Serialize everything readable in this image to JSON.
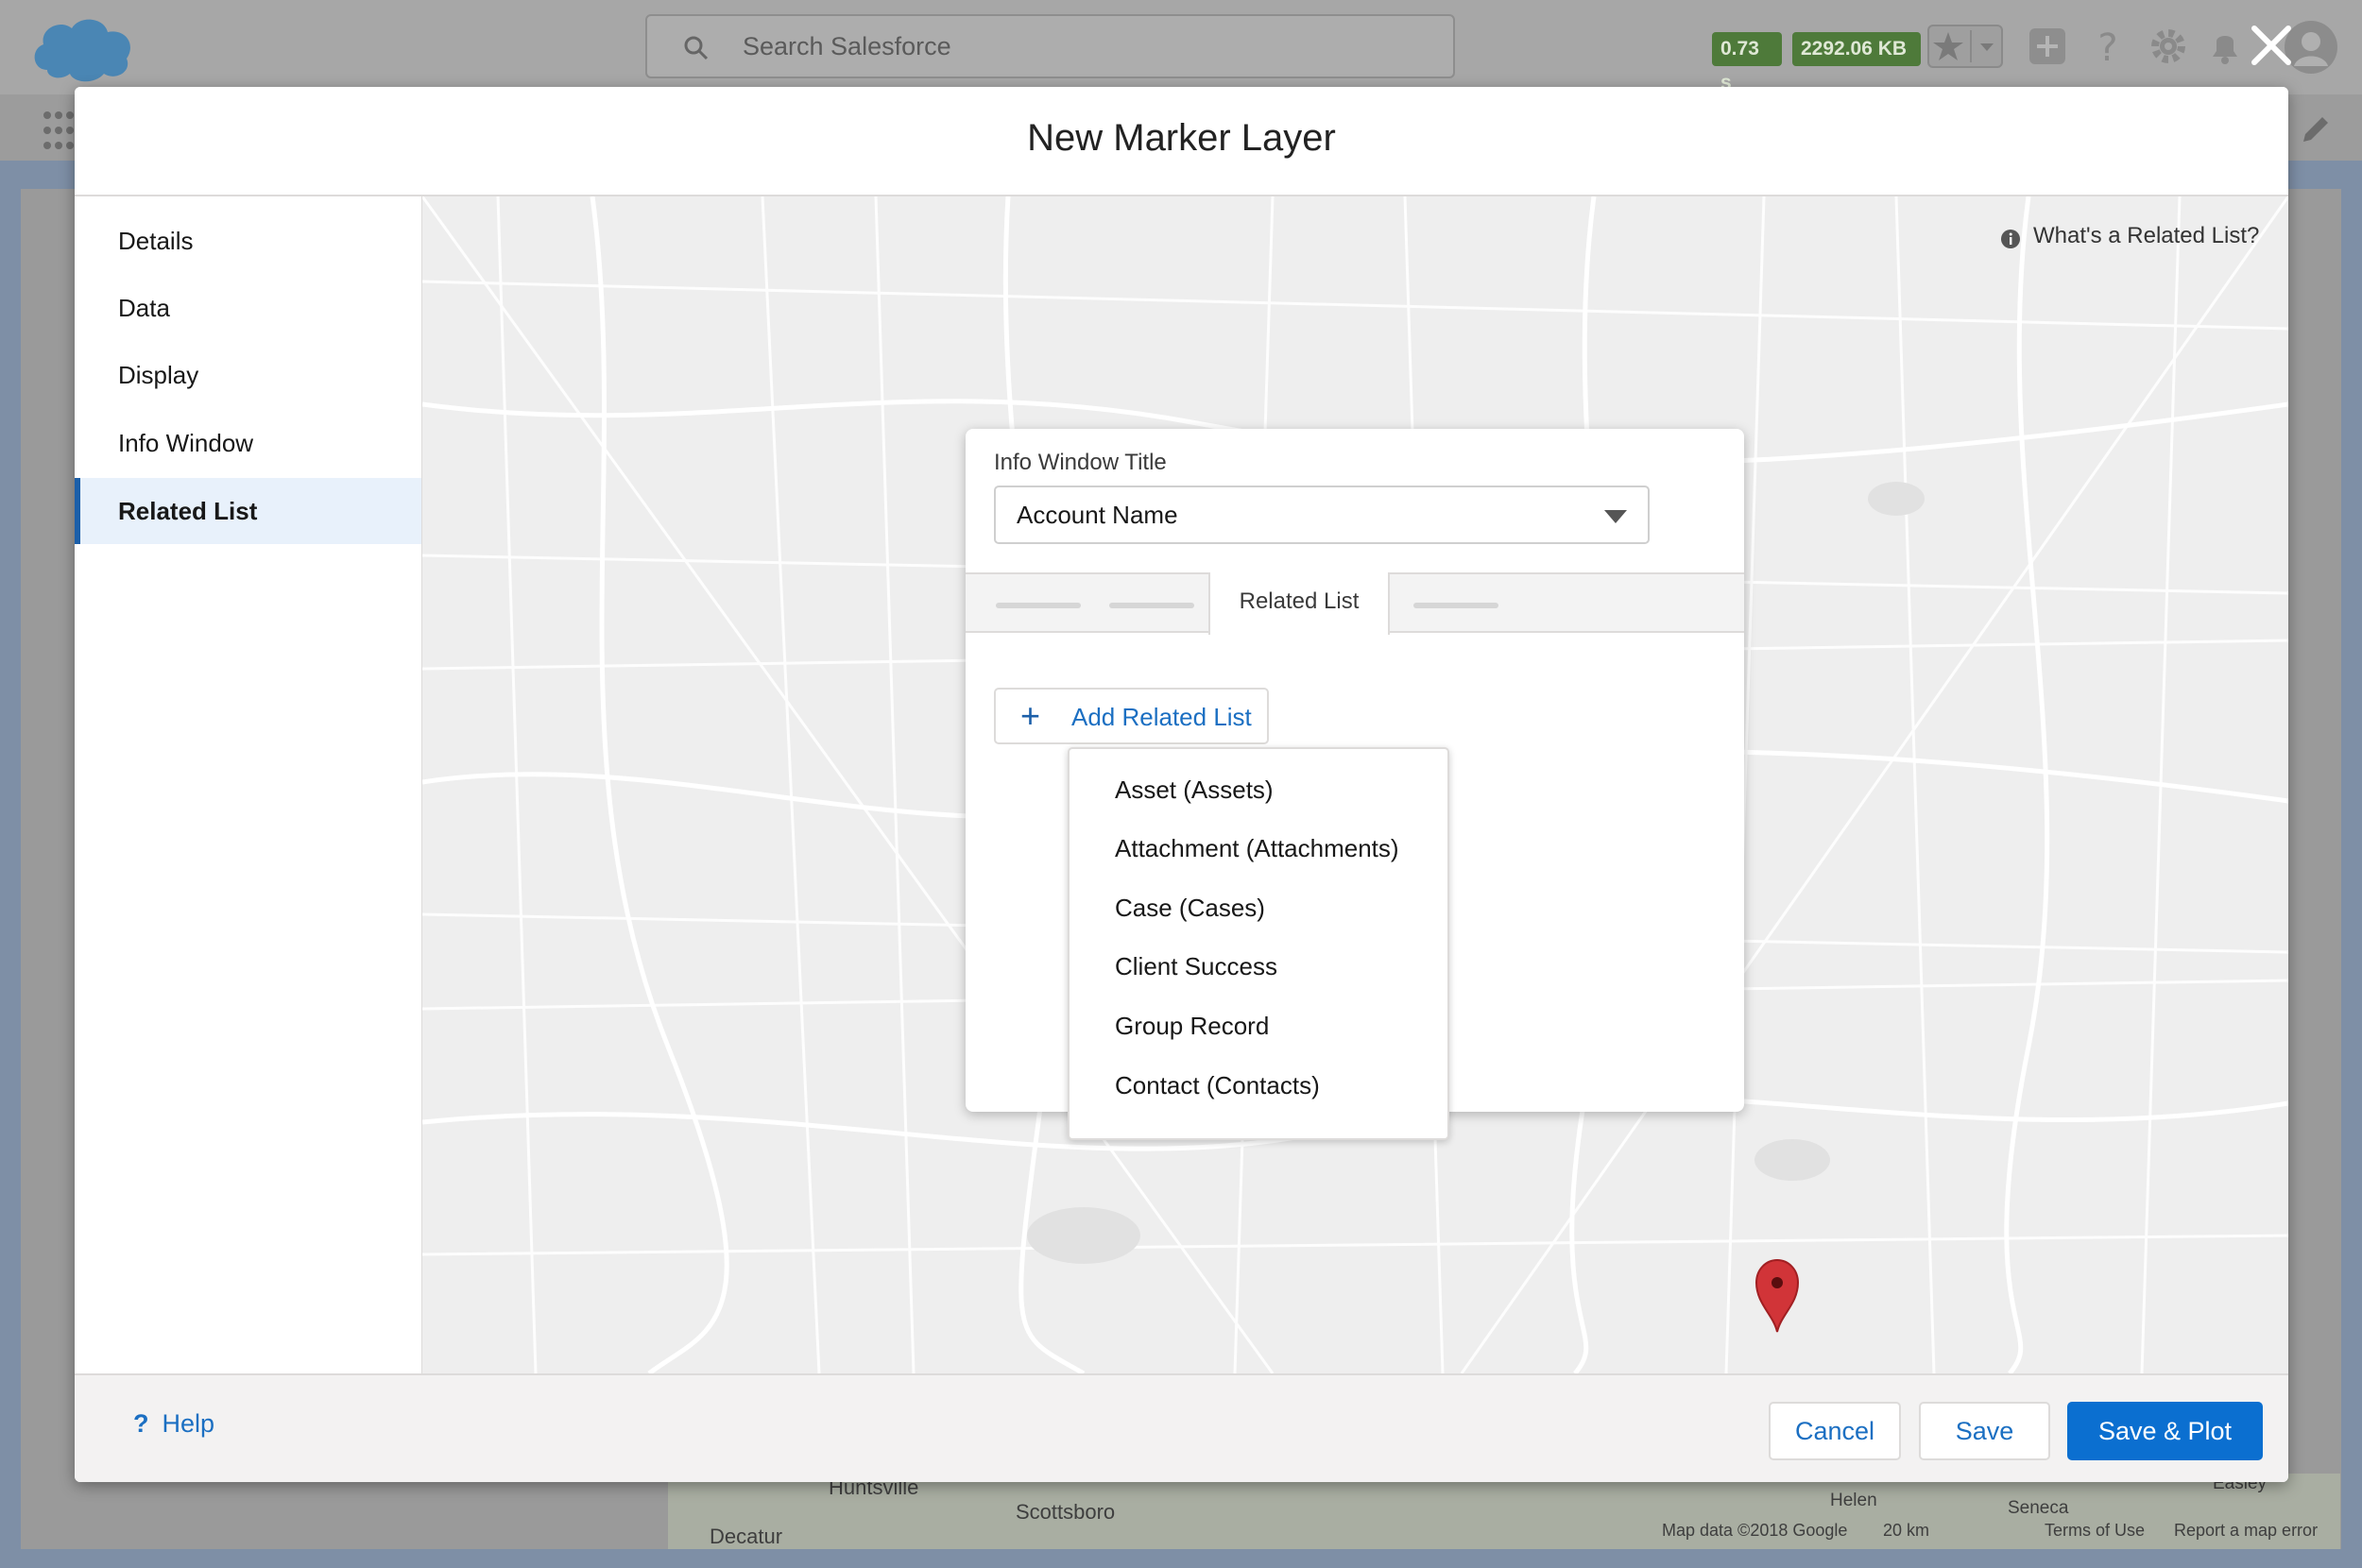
{
  "header": {
    "search_placeholder": "Search Salesforce",
    "perf_time": "0.73 s",
    "perf_memory": "2292.06 KB"
  },
  "background_map": {
    "labels": [
      "Huntsville",
      "Scottsboro",
      "Decatur",
      "Helen",
      "Seneca",
      "Easley",
      "Map data ©2018 Google",
      "20 km",
      "Terms of Use",
      "Report a map error"
    ]
  },
  "modal": {
    "title": "New Marker Layer",
    "sidebar": {
      "items": [
        {
          "label": "Details",
          "active": false
        },
        {
          "label": "Data",
          "active": false
        },
        {
          "label": "Display",
          "active": false
        },
        {
          "label": "Info Window",
          "active": false
        },
        {
          "label": "Related List",
          "active": true
        }
      ]
    },
    "map_help_link": "What's a Related List?",
    "panel": {
      "info_window_title_label": "Info Window Title",
      "info_window_title_value": "Account Name",
      "active_tab": "Related List",
      "add_related_list_label": "Add Related List"
    },
    "dropdown": {
      "options": [
        "Asset (Assets)",
        "Attachment (Attachments)",
        "Case (Cases)",
        "Client Success",
        "Group Record",
        "Contact (Contacts)"
      ]
    },
    "footer": {
      "help_label": "Help",
      "cancel_label": "Cancel",
      "save_label": "Save",
      "save_plot_label": "Save & Plot"
    }
  },
  "colors": {
    "brand_blue": "#0b6fd0",
    "link_blue": "#1b6fc2",
    "active_sidebar_bg": "#e8f1fb",
    "pin_red": "#d13438"
  }
}
